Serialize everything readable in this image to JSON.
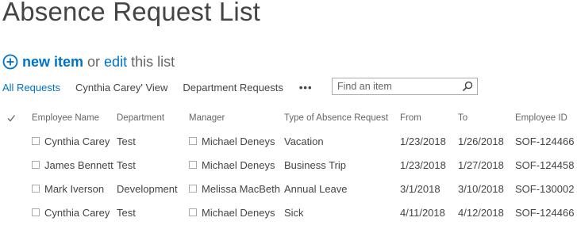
{
  "title": "Absence Request List",
  "newbar": {
    "new_item": "new item",
    "or": "or",
    "edit": "edit",
    "this_list": "this list"
  },
  "views": [
    "All Requests",
    "Cynthia Carey' View",
    "Department Requests"
  ],
  "more": "•••",
  "search": {
    "placeholder": "Find an item"
  },
  "columns": [
    "Employee Name",
    "Department",
    "Manager",
    "Type of Absence Request",
    "From",
    "To",
    "Employee ID"
  ],
  "rows": [
    [
      "Cynthia Carey",
      "Test",
      "Michael Deneys",
      "Vacation",
      "1/23/2018",
      "1/26/2018",
      "SOF-124466"
    ],
    [
      "James Bennett",
      "Test",
      "Michael Deneys",
      "Business Trip",
      "1/23/2018",
      "1/27/2018",
      "SOF-124458"
    ],
    [
      "Mark Iverson",
      "Development",
      "Melissa MacBeth",
      "Annual Leave",
      "3/1/2018",
      "3/10/2018",
      "SOF-130002"
    ],
    [
      "Cynthia Carey",
      "Test",
      "Michael Deneys",
      "Sick",
      "4/11/2018",
      "4/12/2018",
      "SOF-124466"
    ]
  ],
  "colors": {
    "accent": "#0072c6",
    "text": "#444444",
    "muted": "#666666"
  }
}
